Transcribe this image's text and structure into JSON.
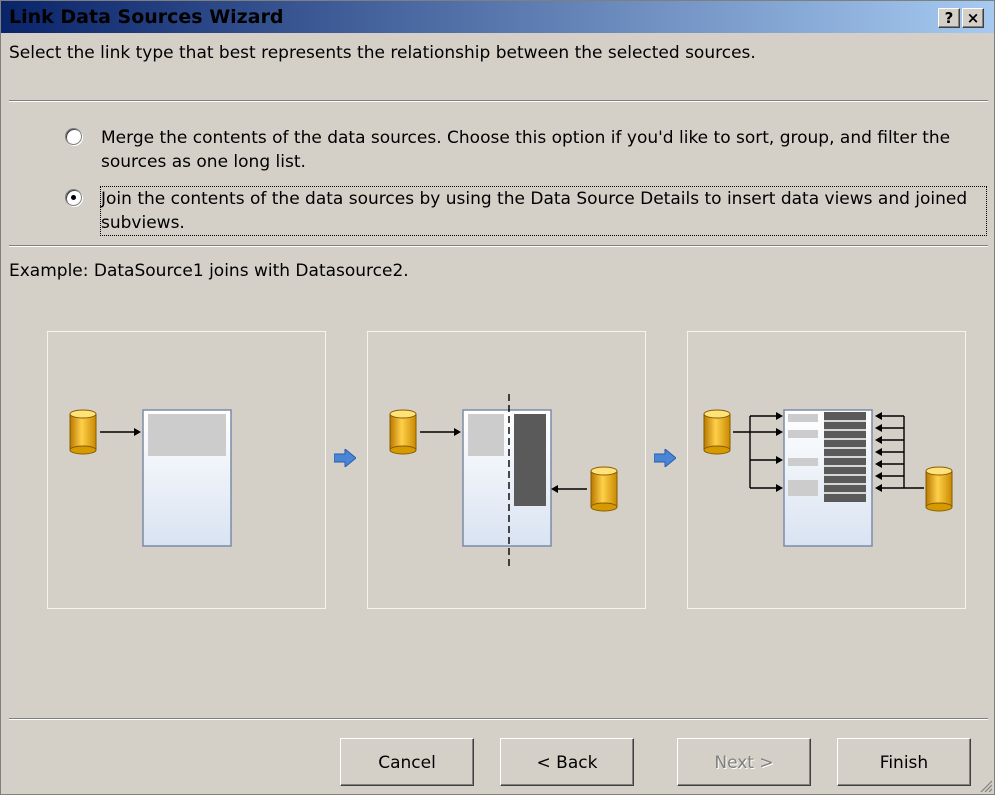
{
  "window": {
    "title": "Link Data Sources Wizard",
    "help_label": "?",
    "close_label": "×"
  },
  "instruction": "Select the link type that best represents the relationship between the selected sources.",
  "options": [
    {
      "label": "Merge the contents of the data sources. Choose this option if you'd like to sort, group, and filter the sources as one long list.",
      "selected": false
    },
    {
      "label": "Join the contents of the data sources by using the Data Source Details to insert data views and joined subviews.",
      "selected": true
    }
  ],
  "example": {
    "caption": "Example: DataSource1 joins with Datasource2.",
    "panels": [
      {
        "icons": [
          "database-icon",
          "arrow-right-icon",
          "page-icon"
        ]
      },
      {
        "icons": [
          "database-icon",
          "arrow-right-icon",
          "page-icon",
          "arrow-left-icon",
          "database-icon"
        ]
      },
      {
        "icons": [
          "database-icon",
          "connector-arrows-icon",
          "page-icon",
          "connector-arrows-icon",
          "database-icon"
        ]
      }
    ],
    "step_arrow_icon": "blue-right-arrow-icon"
  },
  "buttons": {
    "cancel": "Cancel",
    "back": "< Back",
    "next": "Next >",
    "finish": "Finish",
    "next_enabled": false
  },
  "colors": {
    "dialog_bg": "#d4d0c8",
    "title_gradient_start": "#0a246a",
    "title_gradient_end": "#a6caf0",
    "db_gold": "#e8a800",
    "step_arrow_blue": "#4a86d8"
  }
}
